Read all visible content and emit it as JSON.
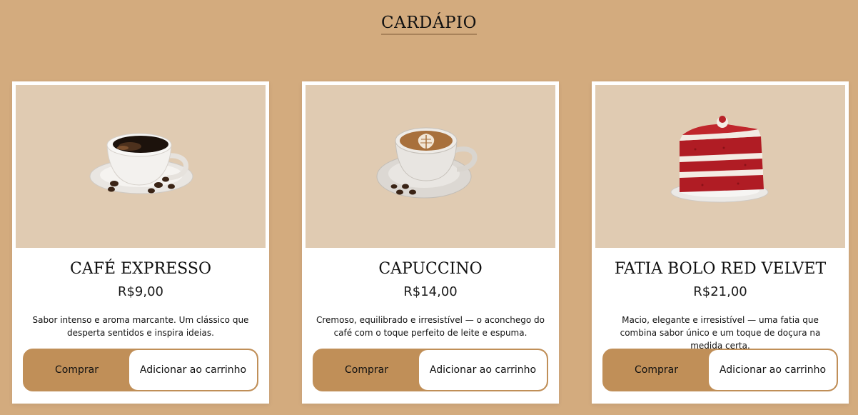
{
  "page": {
    "title": "CARDÁPIO"
  },
  "colors": {
    "background": "#d3ab7e",
    "card": "#ffffff",
    "image_background": "#e0cbb2",
    "accent": "#c08f58"
  },
  "products": [
    {
      "name": "CAFÉ EXPRESSO",
      "price": "R$9,00",
      "description": "Sabor intenso e aroma marcante. Um clássico que desperta sentidos e inspira ideias.",
      "image_icon": "espresso-cup-icon",
      "buy_label": "Comprar",
      "cart_label": "Adicionar ao carrinho"
    },
    {
      "name": "CAPUCCINO",
      "price": "R$14,00",
      "description": "Cremoso, equilibrado e irresistível — o aconchego do café com o toque perfeito de leite e espuma.",
      "image_icon": "cappuccino-cup-icon",
      "buy_label": "Comprar",
      "cart_label": "Adicionar ao carrinho"
    },
    {
      "name": "FATIA BOLO RED VELVET",
      "price": "R$21,00",
      "description": "Macio, elegante e irresistível — uma fatia que combina sabor único e um toque de doçura na medida certa.",
      "image_icon": "red-velvet-cake-icon",
      "buy_label": "Comprar",
      "cart_label": "Adicionar ao carrinho"
    }
  ]
}
